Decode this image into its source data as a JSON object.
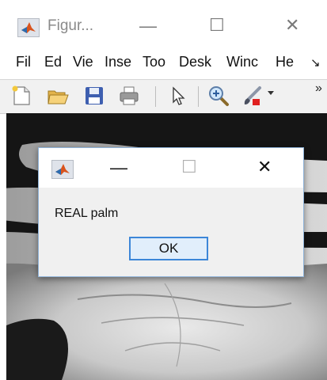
{
  "window": {
    "title": "Figur...",
    "min_glyph": "—",
    "max_glyph": "☐",
    "close_glyph": "✕"
  },
  "menubar": {
    "items": [
      "Fil",
      "Ed",
      "Vie",
      "Inse",
      "Too",
      "Desk",
      "Winc",
      "He"
    ],
    "overflow_glyph": "↘"
  },
  "toolbar": {
    "tools": [
      "new-figure-icon",
      "open-file-icon",
      "save-icon",
      "print-icon",
      "pointer-icon",
      "zoom-in-icon",
      "brush-icon"
    ],
    "overflow_glyph": "»"
  },
  "dialog": {
    "message": "REAL palm",
    "ok_label": "OK",
    "min_glyph": "—",
    "max_glyph": "☐",
    "close_glyph": "✕"
  },
  "colors": {
    "accent": "#3c86d8",
    "dialog_bg": "#f0f0f0",
    "toolbar_bg": "#f1f1f1"
  }
}
